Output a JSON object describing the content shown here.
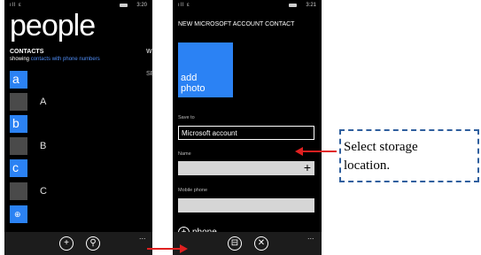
{
  "phone1": {
    "status": {
      "signal": "ıll ε",
      "time": "3:20"
    },
    "title": "people",
    "pivot_contacts": "CONTACTS",
    "pivot_next": "W",
    "showing_prefix": "showing",
    "showing_link": "contacts with phone numbers",
    "partial_right": "SE",
    "rows": [
      {
        "letter": "a",
        "name": ""
      },
      {
        "letter": "",
        "name": "A"
      },
      {
        "letter": "b",
        "name": ""
      },
      {
        "letter": "",
        "name": "B"
      },
      {
        "letter": "c",
        "name": ""
      },
      {
        "letter": "",
        "name": "C"
      }
    ],
    "globe_glyph": "⊕",
    "appbar": {
      "add": "+",
      "search": "⚲",
      "more": "..."
    }
  },
  "phone2": {
    "status": {
      "signal": "ıll ε",
      "time": "3:21"
    },
    "header": "NEW MICROSOFT ACCOUNT CONTACT",
    "add_photo_line1": "add",
    "add_photo_line2": "photo",
    "save_to_label": "Save to",
    "save_to_value": "Microsoft account",
    "name_label": "Name",
    "mobile_label": "Mobile phone",
    "add_phone": "phone",
    "appbar": {
      "save": "⊟",
      "cancel": "✕",
      "more": "..."
    }
  },
  "callout": {
    "line1": "Select storage",
    "line2": "location."
  },
  "colors": {
    "arrow": "#e02020",
    "accent": "#2b82f4",
    "callout_border": "#2f5f9e"
  }
}
